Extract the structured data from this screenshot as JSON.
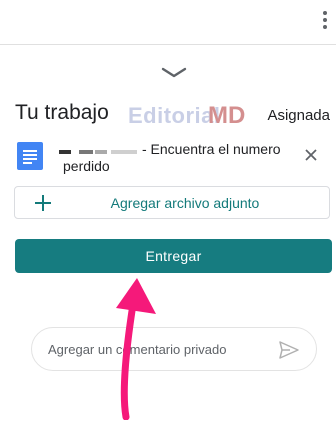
{
  "menu": {
    "icon": "more-vert-icon"
  },
  "sheet": {
    "handle_icon": "chevron-down-icon"
  },
  "work": {
    "title": "Tu trabajo",
    "status": "Asignada"
  },
  "watermark": {
    "text": "Editorial",
    "logo_text": "MD"
  },
  "attachment": {
    "icon": "google-docs-icon",
    "name_line1": "- Encuentra el numero",
    "name_line2": "perdido",
    "remove_icon": "close-icon"
  },
  "actions": {
    "add_attachment_label": "Agregar archivo adjunto",
    "add_icon": "plus-icon",
    "submit_label": "Entregar"
  },
  "comment": {
    "placeholder": "Agregar un comentario privado",
    "send_icon": "send-icon"
  },
  "colors": {
    "accent": "#167c80",
    "accent_text": "#137a7a",
    "doc_blue": "#4285f4",
    "annotation_arrow": "#f5197a"
  }
}
